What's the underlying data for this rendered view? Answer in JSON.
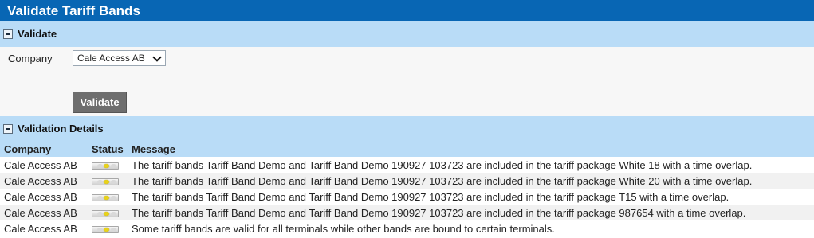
{
  "page": {
    "title": "Validate Tariff Bands"
  },
  "validate_section": {
    "header": "Validate",
    "company_label": "Company",
    "company_value": "Cale Access AB",
    "validate_button": "Validate"
  },
  "details_section": {
    "header": "Validation Details",
    "columns": [
      "Company",
      "Status",
      "Message"
    ],
    "rows": [
      {
        "company": "Cale Access AB",
        "status": "warning",
        "message": "The tariff bands Tariff Band Demo and Tariff Band Demo 190927 103723 are included in the tariff package White 18 with a time overlap."
      },
      {
        "company": "Cale Access AB",
        "status": "warning",
        "message": "The tariff bands Tariff Band Demo and Tariff Band Demo 190927 103723 are included in the tariff package White 20 with a time overlap."
      },
      {
        "company": "Cale Access AB",
        "status": "warning",
        "message": "The tariff bands Tariff Band Demo and Tariff Band Demo 190927 103723 are included in the tariff package T15 with a time overlap."
      },
      {
        "company": "Cale Access AB",
        "status": "warning",
        "message": "The tariff bands Tariff Band Demo and Tariff Band Demo 190927 103723 are included in the tariff package 987654 with a time overlap."
      },
      {
        "company": "Cale Access AB",
        "status": "warning",
        "message": "Some tariff bands are valid for all terminals while other bands are bound to certain terminals."
      }
    ]
  },
  "colors": {
    "title_bar": "#0866b4",
    "section_header": "#b9dcf7",
    "status_warning": "#e8d21a"
  },
  "icons": {
    "collapse": "collapse-icon",
    "status": "status-warning-icon",
    "dropdown": "chevron-down-icon"
  }
}
